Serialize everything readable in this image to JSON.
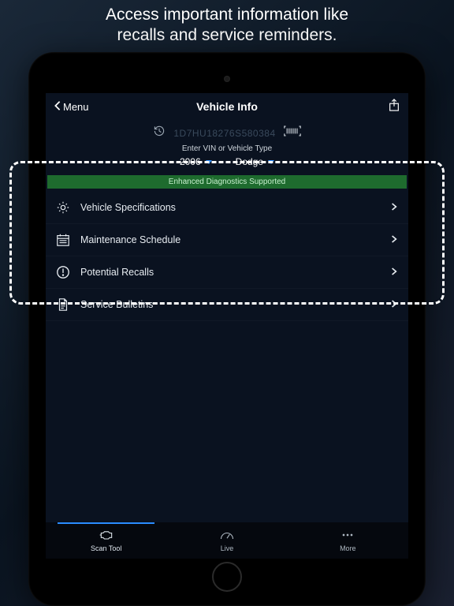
{
  "promo": {
    "line1": "Access important information like",
    "line2": "recalls and service reminders."
  },
  "header": {
    "back_label": "Menu",
    "title": "Vehicle Info"
  },
  "vin": {
    "value": "1D7HU18276S580384",
    "hint": "Enter VIN or Vehicle Type"
  },
  "dropdowns": {
    "year": "2006",
    "make": "Dodge"
  },
  "banner": {
    "text": "Enhanced Diagnostics Supported"
  },
  "items": [
    {
      "label": "Vehicle Specifications"
    },
    {
      "label": "Maintenance Schedule"
    },
    {
      "label": "Potential Recalls"
    },
    {
      "label": "Service Bulletins"
    }
  ],
  "tabs": {
    "scan": "Scan Tool",
    "live": "Live",
    "more": "More"
  }
}
